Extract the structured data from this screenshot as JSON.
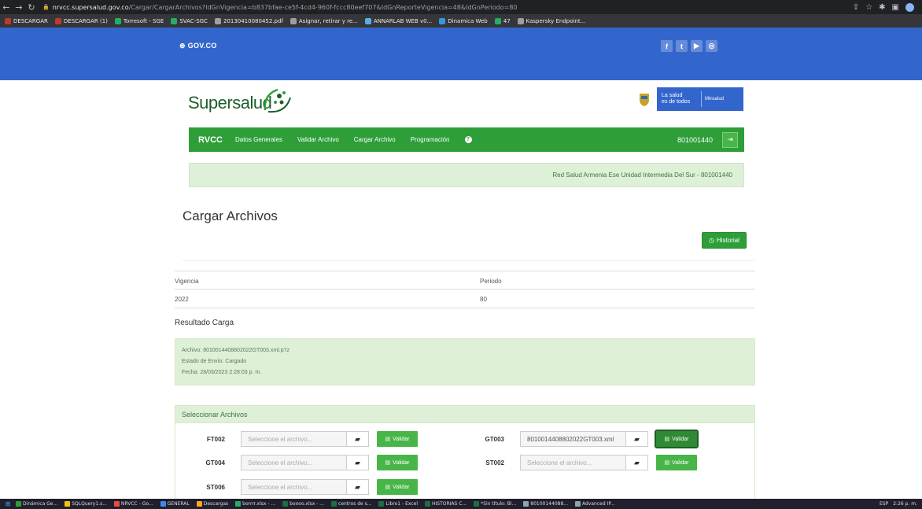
{
  "browser": {
    "url_host": "nrvcc.supersalud.gov.co",
    "url_path": "/Cargar/CargarArchivos?IdGnVigencia=b837bfae-ce5f-4cd4-960f-fccc80eef707&IdGnReporteVigencia=48&IdGnPeriodo=80",
    "bookmarks": [
      {
        "label": "DESCARGAR",
        "color": "#c0392b"
      },
      {
        "label": "DESCARGAR (1)",
        "color": "#c0392b"
      },
      {
        "label": "Torresoft - SGE",
        "color": "#27ae60"
      },
      {
        "label": "SVAC-SGC",
        "color": "#27ae60"
      },
      {
        "label": "20130410080452.pdf",
        "color": "#9e9e9e"
      },
      {
        "label": "Asignar, retirar y re...",
        "color": "#9e9e9e"
      },
      {
        "label": "ANNARLAB WEB v0...",
        "color": "#5dade2"
      },
      {
        "label": "Dinamica Web",
        "color": "#3498db"
      },
      {
        "label": "47",
        "color": "#27ae60"
      },
      {
        "label": "Kaspersky Endpoint...",
        "color": "#9e9e9e"
      }
    ]
  },
  "gov": {
    "logo": "GOV.CO",
    "social": [
      "f",
      "t",
      "▶",
      "◎"
    ]
  },
  "brand": {
    "name": "Supersalud",
    "slogan_line1": "La salud",
    "slogan_line2": "es de todos",
    "ministry": "Minsalud"
  },
  "nav": {
    "app": "RVCC",
    "items": [
      "Datos Generales",
      "Validar Archivo",
      "Cargar Archivo",
      "Programación"
    ],
    "nit": "801001440"
  },
  "entity": "Red Salud Armenia Ese Unidad Intermedia Del Sur - 801001440",
  "page": {
    "title": "Cargar Archivos",
    "history_button": "Historial"
  },
  "info": {
    "headers": [
      "Vigencia",
      "Periodo"
    ],
    "values": [
      "2022",
      "80"
    ]
  },
  "result": {
    "title": "Resultado Carga",
    "file": "Archivo: 8010014408802022GT003.xml.p7z",
    "status": "Estado de Envío: Cargado",
    "date": "Fecha: 28/03/2023 2:28:03 p. m."
  },
  "select": {
    "title": "Seleccionar Archivos",
    "placeholder": "Seleccione el archivo...",
    "validate": "Validar",
    "files": [
      {
        "code": "FT002",
        "value": ""
      },
      {
        "code": "GT003",
        "value": "8010014408802022GT003.xml"
      },
      {
        "code": "GT004",
        "value": ""
      },
      {
        "code": "ST002",
        "value": ""
      },
      {
        "code": "ST006",
        "value": ""
      }
    ]
  },
  "taskbar": {
    "items": [
      "Dinámica Ge...",
      "SQLQuery1.s...",
      "NRVCC - Go...",
      "GENERAL",
      "Descargas",
      "borrrr.xlsx - ...",
      "boooo.xlsx - ...",
      "centros de s...",
      "Libro1 - Excel",
      "HISTORIAS C...",
      "*Sin título: Bl...",
      "80100144088...",
      "Advanced IP..."
    ],
    "lang": "ESP",
    "time": "2:26 p. m."
  }
}
